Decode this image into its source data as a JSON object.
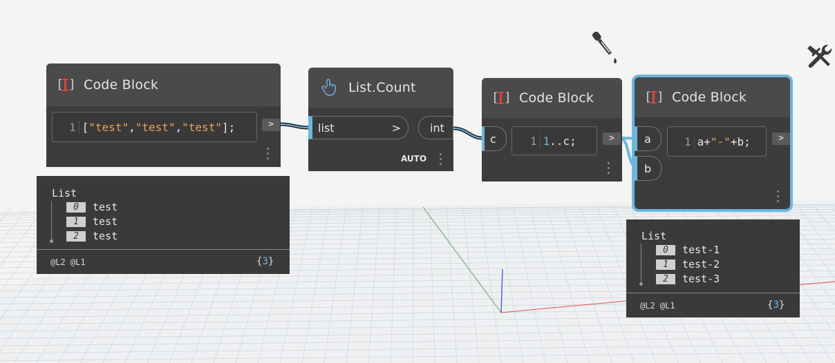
{
  "nodes": {
    "cb1": {
      "title": "Code Block",
      "line_no": "1",
      "code_tokens": [
        {
          "t": "[",
          "c": "op"
        },
        {
          "t": "\"test\"",
          "c": "str"
        },
        {
          "t": ",",
          "c": "op"
        },
        {
          "t": "\"test\"",
          "c": "str"
        },
        {
          "t": ",",
          "c": "op"
        },
        {
          "t": "\"test\"",
          "c": "str"
        },
        {
          "t": "];",
          "c": "op"
        }
      ],
      "out_label": ">"
    },
    "listcount": {
      "title": "List.Count",
      "input_label": "list",
      "input_arrow": ">",
      "output_label": "int",
      "lacing": "AUTO"
    },
    "cb2": {
      "title": "Code Block",
      "input_label": "c",
      "line_no": "1",
      "code_tokens": [
        {
          "t": "1",
          "c": "num"
        },
        {
          "t": "..c;",
          "c": "op"
        }
      ],
      "out_label": ">"
    },
    "cb3": {
      "title": "Code Block",
      "input_a": "a",
      "input_b": "b",
      "line_no": "1",
      "code_tokens": [
        {
          "t": "a+",
          "c": "op"
        },
        {
          "t": "\"-\"",
          "c": "str"
        },
        {
          "t": "+b;",
          "c": "op"
        }
      ],
      "out_label": ">"
    }
  },
  "previews": {
    "p1": {
      "title": "List",
      "items": [
        {
          "index": "0",
          "value": "test"
        },
        {
          "index": "1",
          "value": "test"
        },
        {
          "index": "2",
          "value": "test"
        }
      ],
      "levels": "@L2 @L1",
      "count_open": "{",
      "count": "3",
      "count_close": "}"
    },
    "p2": {
      "title": "List",
      "items": [
        {
          "index": "0",
          "value": "test-1"
        },
        {
          "index": "1",
          "value": "test-2"
        },
        {
          "index": "2",
          "value": "test-3"
        }
      ],
      "levels": "@L2 @L1",
      "count_open": "{",
      "count": "3",
      "count_close": "}"
    }
  },
  "icons": {
    "dropper": "eyedropper-icon",
    "tools": "wrench-screwdriver-icon",
    "listcount": "hand-pointer-icon",
    "codeblock": "code-block-icon"
  },
  "colors": {
    "background": "#f4f4f4",
    "node_body": "#3c3c3c",
    "node_header": "#4a4a4a",
    "selection": "#6db6e0",
    "string": "#e8a35a",
    "number": "#6db6e0"
  }
}
